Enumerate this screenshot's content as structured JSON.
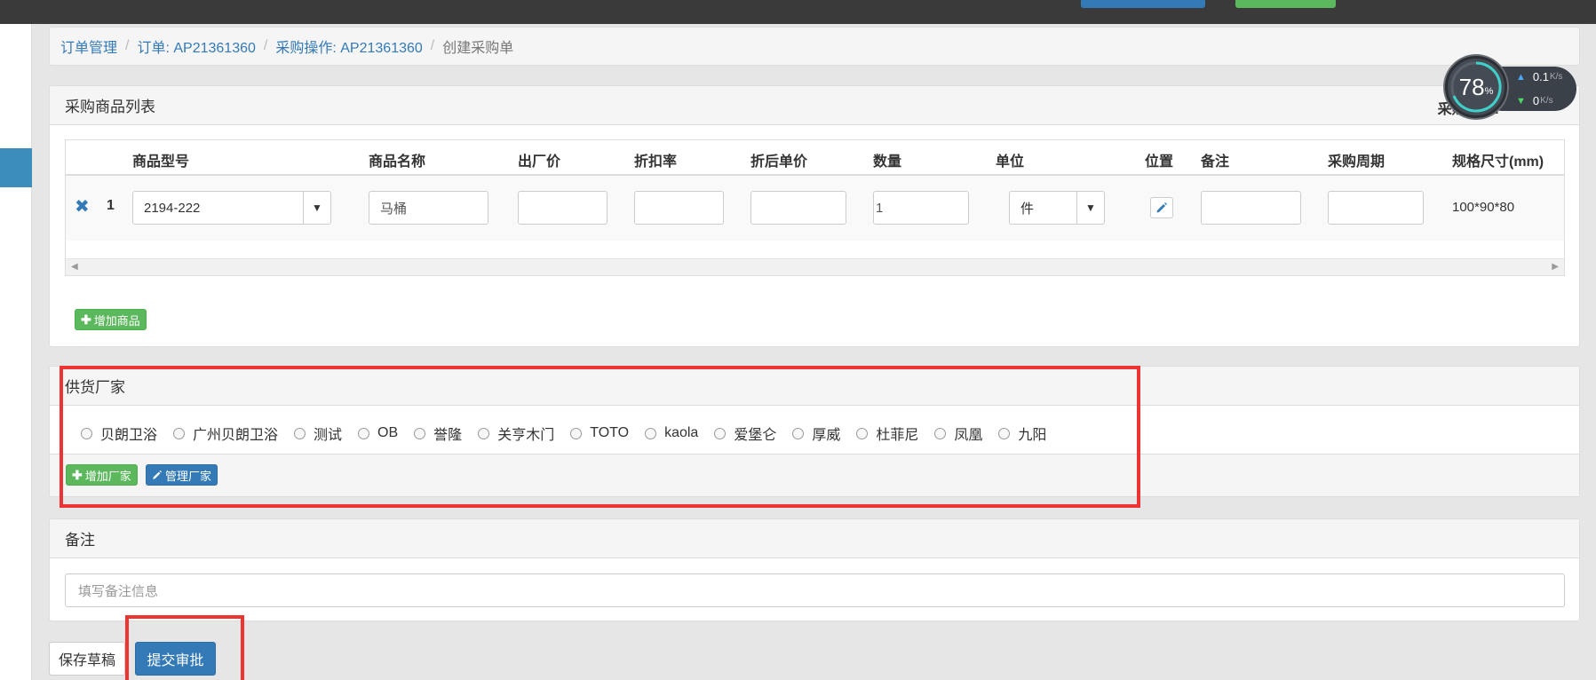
{
  "breadcrumb": {
    "items": [
      "订单管理",
      "订单: AP21361360",
      "采购操作: AP21361360"
    ],
    "current": "创建采购单"
  },
  "products": {
    "title": "采购商品列表",
    "source_label": "采购来源:",
    "columns": [
      "商品型号",
      "商品名称",
      "出厂价",
      "折扣率",
      "折后单价",
      "数量",
      "单位",
      "位置",
      "备注",
      "采购周期",
      "规格尺寸(mm)"
    ],
    "rows": [
      {
        "index": "1",
        "model": "2194-222",
        "name": "马桶",
        "factory_price": "",
        "discount_rate": "",
        "discount_price": "",
        "quantity": "1",
        "unit": "件",
        "remark": "",
        "cycle": "",
        "size": "100*90*80"
      }
    ],
    "add_button": "增加商品"
  },
  "suppliers": {
    "title": "供货厂家",
    "options": [
      "贝朗卫浴",
      "广州贝朗卫浴",
      "测试",
      "OB",
      "誉隆",
      "关亨木门",
      "TOTO",
      "kaola",
      "爱堡仑",
      "厚威",
      "杜菲尼",
      "凤凰",
      "九阳"
    ],
    "add_button": "增加厂家",
    "manage_button": "管理厂家"
  },
  "remarks": {
    "title": "备注",
    "placeholder": "填写备注信息"
  },
  "actions": {
    "save_draft": "保存草稿",
    "submit": "提交审批"
  },
  "widget": {
    "percent": "78",
    "percent_sign": "%",
    "upload": "0.1",
    "download": "0",
    "unit": "K/s"
  },
  "colors": {
    "primary": "#337ab7",
    "success": "#5cb85c",
    "annotation": "#ee3333"
  }
}
